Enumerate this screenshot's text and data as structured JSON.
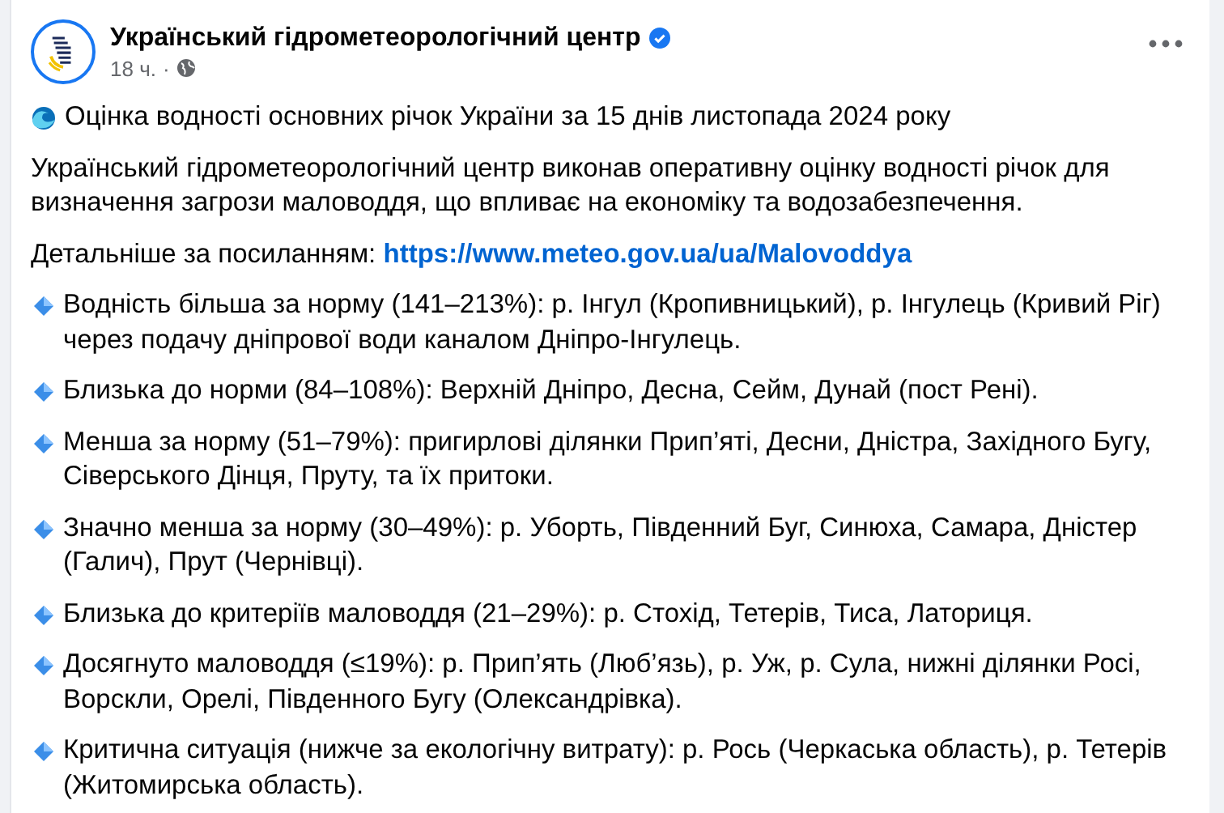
{
  "post": {
    "author": "Український гідрометеорологічний центр",
    "verified": true,
    "time": "18 ч.",
    "separator": "·",
    "title": "Оцінка водності основних річок України за 15 днів листопада 2024 року",
    "intro": "Український гідрометеорологічний центр виконав оперативну оцінку водності річок для визначення загрози маловоддя, що впливає на економіку та водозабезпечення.",
    "link_label": "Детальніше за посиланням:",
    "link": "https://www.meteo.gov.ua/ua/Malovoddya",
    "bullets": [
      {
        "text": "Водність більша за норму (141–213%): р. Інгул (Кропивницький), р. Інгулець (Кривий Ріг) через подачу дніпрової води каналом Дніпро-Інгулець."
      },
      {
        "text": "Близька до норми (84–108%): Верхній Дніпро, Десна, Сейм, Дунай (пост Рені)."
      },
      {
        "text": "Менша за норму (51–79%): пригирлові ділянки Прип’яті, Десни, Дністра, Західного Бугу, Сіверського Дінця, Пруту, та їх притоки."
      },
      {
        "text": "Значно менша за норму (30–49%): р. Уборть, Південний Буг, Синюха, Самара, Дністер (Галич), Прут (Чернівці)."
      },
      {
        "text": "Близька до критеріїв маловоддя (21–29%): р. Стохід, Тетерів, Тиса, Латориця."
      },
      {
        "text": "Досягнуто маловоддя (≤19%): р. Прип’ять (Люб’язь), р. Уж, р. Сула, нижні ділянки Росі, Ворскли, Орелі, Південного Бугу (Олександрівка)."
      },
      {
        "text": "Критична ситуація (нижче за екологічну витрату): р. Рось (Черкаська область), р. Тетерів (Житомирська область)."
      }
    ]
  }
}
